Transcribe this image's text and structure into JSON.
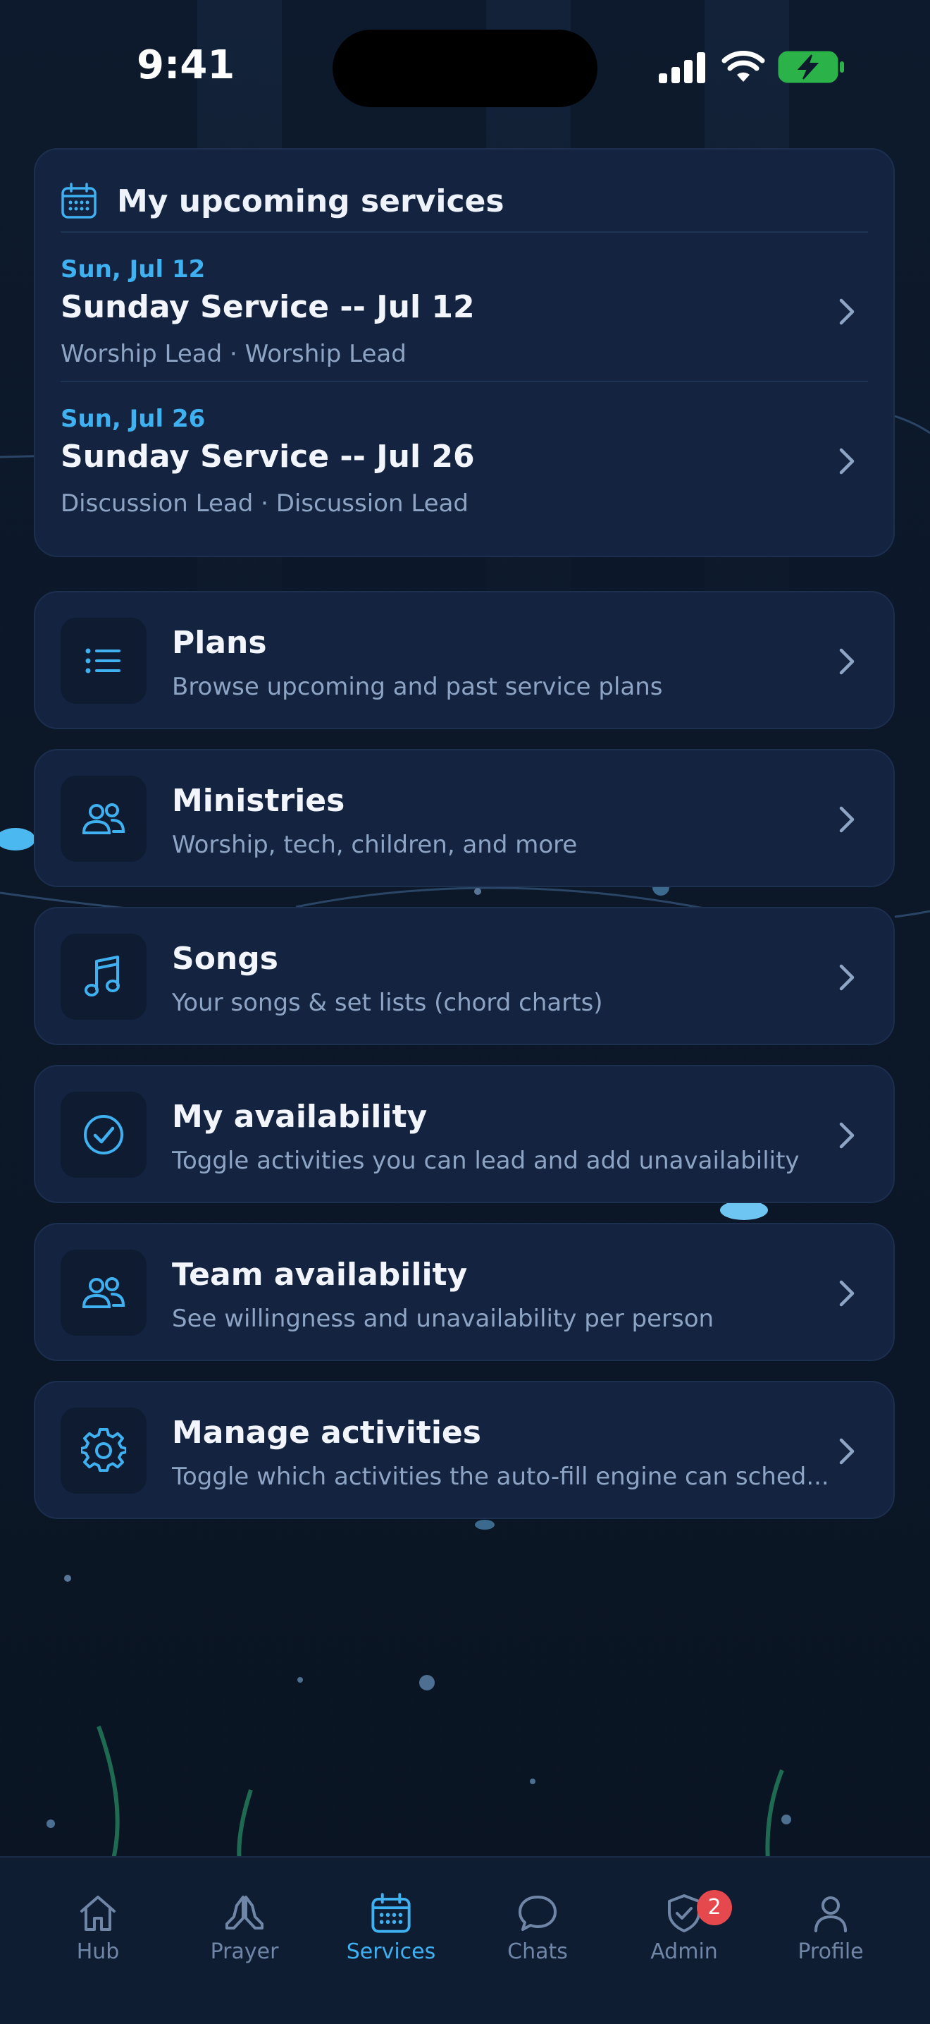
{
  "status_bar": {
    "time": "9:41"
  },
  "upcoming": {
    "title": "My upcoming services",
    "services": [
      {
        "date": "Sun, Jul 12",
        "name": "Sunday Service -- Jul 12",
        "roles": "Worship Lead · Worship Lead"
      },
      {
        "date": "Sun, Jul 26",
        "name": "Sunday Service -- Jul 26",
        "roles": "Discussion Lead · Discussion Lead"
      }
    ]
  },
  "menu": [
    {
      "label": "Plans",
      "subtitle": "Browse upcoming and past service plans",
      "icon": "list-icon"
    },
    {
      "label": "Ministries",
      "subtitle": "Worship, tech, children, and more",
      "icon": "people-icon"
    },
    {
      "label": "Songs",
      "subtitle": "Your songs & set lists (chord charts)",
      "icon": "music-note-icon"
    },
    {
      "label": "My availability",
      "subtitle": "Toggle activities you can lead and add unavailability",
      "icon": "check-circle-icon"
    },
    {
      "label": "Team availability",
      "subtitle": "See willingness and unavailability per person",
      "icon": "people-icon"
    },
    {
      "label": "Manage activities",
      "subtitle": "Toggle which activities the auto-fill engine can sched...",
      "icon": "gear-icon"
    }
  ],
  "tabs": [
    {
      "label": "Hub",
      "icon": "home-icon"
    },
    {
      "label": "Prayer",
      "icon": "praying-hands-icon"
    },
    {
      "label": "Services",
      "icon": "calendar-icon",
      "active": true
    },
    {
      "label": "Chats",
      "icon": "chat-bubble-icon"
    },
    {
      "label": "Admin",
      "icon": "shield-check-icon",
      "badge": "2"
    },
    {
      "label": "Profile",
      "icon": "person-icon"
    }
  ],
  "colors": {
    "accent": "#3fb0f0",
    "card": "#132340",
    "badge": "#e5484d",
    "muted": "#8ea4c4"
  }
}
